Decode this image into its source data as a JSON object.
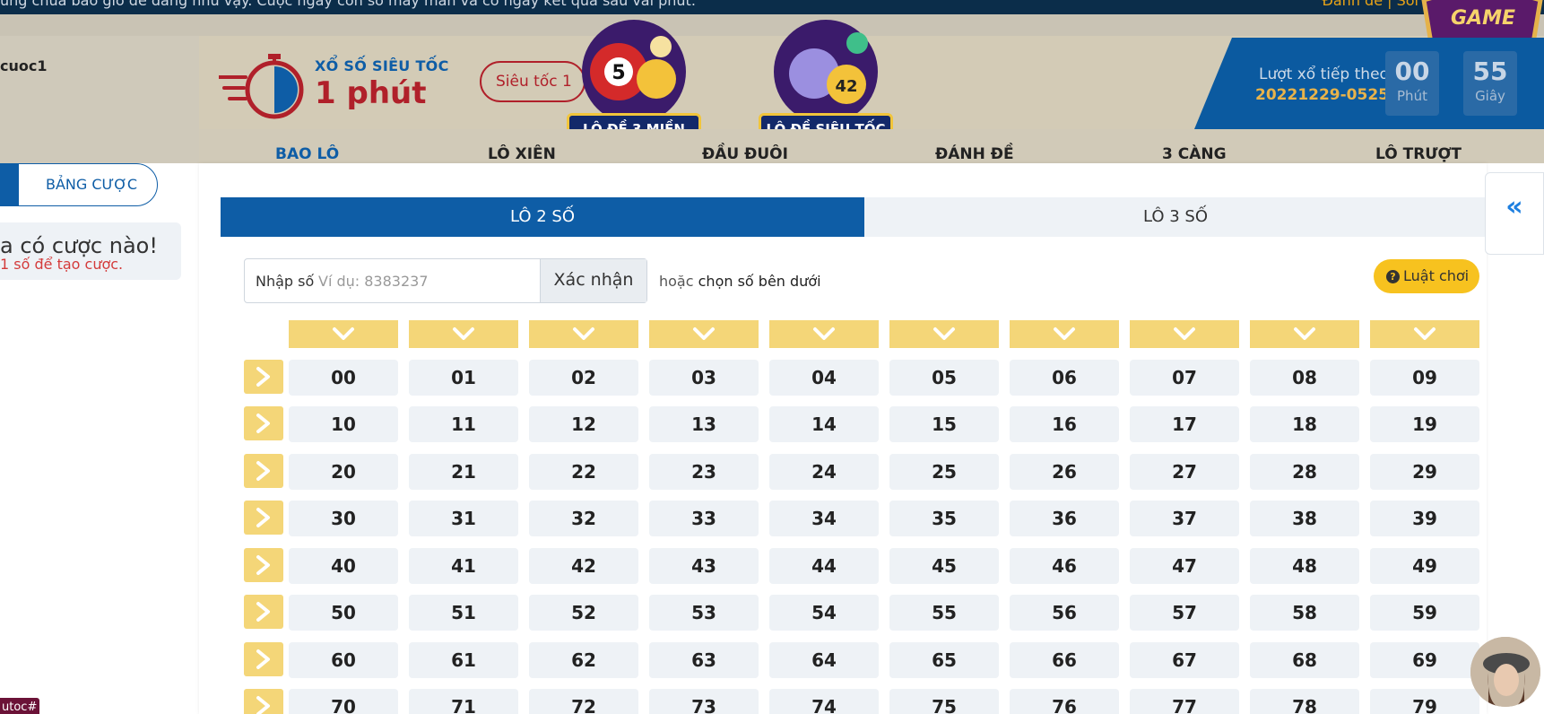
{
  "marquee": {
    "text": "ưng chưa bao giờ dễ dàng như vậy. Cược ngay con số may mắn và có ngay kết quả sau vài phút.",
    "links": "Đánh đề | Soi"
  },
  "user": {
    "name": "cuoc1"
  },
  "game": {
    "type": "XỔ SỐ SIÊU TỐC",
    "duration": "1 phút",
    "select_value": "Siêu tốc 1"
  },
  "promos": {
    "badge1": "LÔ ĐỀ 3 MIỀN",
    "badge2": "LÔ ĐỀ SIÊU TỐC",
    "logo": "GAME"
  },
  "next_draw": {
    "label": "Lượt xổ tiếp theo",
    "id": "20221229-0525",
    "minutes": "00",
    "minutes_unit": "Phút",
    "seconds": "55",
    "seconds_unit": "Giây"
  },
  "tabs": [
    "BAO LÔ",
    "LÔ XIÊN",
    "ĐẦU ĐUÔI",
    "ĐÁNH ĐỀ",
    "3 CÀNG",
    "LÔ TRƯỢT"
  ],
  "sidebar": {
    "bet_board_label": "BẢNG CƯỢC",
    "no_bet_title": "a có cược nào!",
    "no_bet_hint": "1 số để tạo cược.",
    "bottom_tag": "utoc#"
  },
  "subtabs": {
    "lo2": "LÔ 2 SỐ",
    "lo3": "LÔ 3 SỐ"
  },
  "input": {
    "label": "Nhập số",
    "placeholder": "Ví dụ: 8383237",
    "confirm": "Xác nhận",
    "or": "hoặc",
    "or_hint": "chọn số bên dưới"
  },
  "rules_label": "Luật chơi",
  "numbers": [
    [
      "00",
      "01",
      "02",
      "03",
      "04",
      "05",
      "06",
      "07",
      "08",
      "09"
    ],
    [
      "10",
      "11",
      "12",
      "13",
      "14",
      "15",
      "16",
      "17",
      "18",
      "19"
    ],
    [
      "20",
      "21",
      "22",
      "23",
      "24",
      "25",
      "26",
      "27",
      "28",
      "29"
    ],
    [
      "30",
      "31",
      "32",
      "33",
      "34",
      "35",
      "36",
      "37",
      "38",
      "39"
    ],
    [
      "40",
      "41",
      "42",
      "43",
      "44",
      "45",
      "46",
      "47",
      "48",
      "49"
    ],
    [
      "50",
      "51",
      "52",
      "53",
      "54",
      "55",
      "56",
      "57",
      "58",
      "59"
    ],
    [
      "60",
      "61",
      "62",
      "63",
      "64",
      "65",
      "66",
      "67",
      "68",
      "69"
    ],
    [
      "70",
      "71",
      "72",
      "73",
      "74",
      "75",
      "76",
      "77",
      "78",
      "79"
    ]
  ],
  "icons": {
    "timer": "stopwatch-icon",
    "column_select": "chevron-down-icon",
    "row_select": "chevron-right-icon",
    "collapse": "double-chevron-left-icon",
    "rules": "question-circle-icon"
  },
  "colors": {
    "primary": "#0e5da6",
    "accent": "#f4d678",
    "danger": "#b0202a"
  }
}
